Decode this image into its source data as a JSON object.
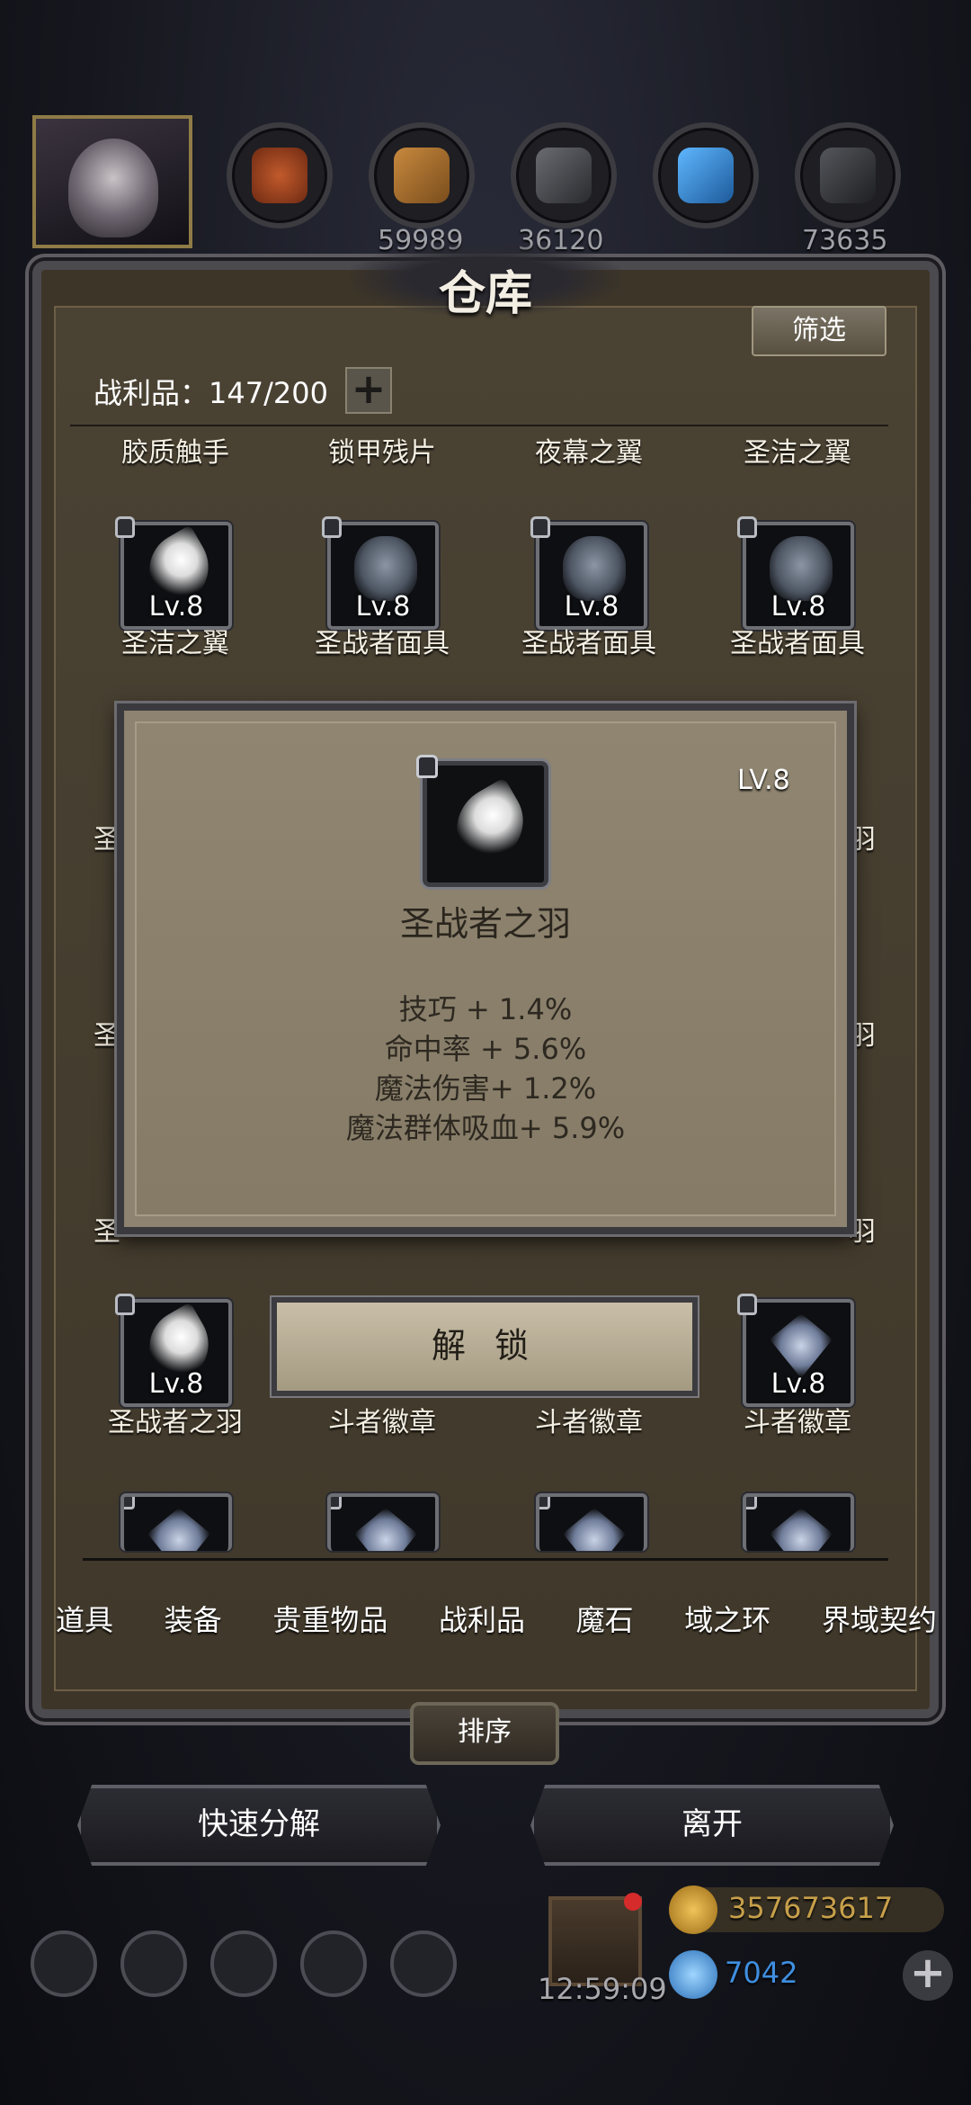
{
  "resources": {
    "values": [
      "59989",
      "36120",
      "",
      "73635"
    ]
  },
  "window": {
    "title": "仓库",
    "filter_label": "筛选",
    "count_label": "战利品：147/200",
    "add_label": "+"
  },
  "grid": {
    "header_labels": [
      "胶质触手",
      "锁甲残片",
      "夜幕之翼",
      "圣洁之翼"
    ],
    "row1": [
      {
        "lv": "Lv.8",
        "name": "圣洁之翼",
        "icon": "feather-icon"
      },
      {
        "lv": "Lv.8",
        "name": "圣战者面具",
        "icon": "mask-icon"
      },
      {
        "lv": "Lv.8",
        "name": "圣战者面具",
        "icon": "mask-icon"
      },
      {
        "lv": "Lv.8",
        "name": "圣战者面具",
        "icon": "mask-icon"
      }
    ],
    "row_bottom": [
      {
        "lv": "Lv.8",
        "name": "圣战者之羽",
        "icon": "feather-icon"
      },
      {
        "lv": "",
        "name": "斗者徽章",
        "icon": "badge-icon"
      },
      {
        "lv": "",
        "name": "斗者徽章",
        "icon": "badge-icon"
      },
      {
        "lv": "Lv.8",
        "name": "斗者徽章",
        "icon": "badge-icon"
      }
    ],
    "side_left": [
      "圣",
      "圣",
      "圣"
    ],
    "side_right": [
      "羽",
      "羽",
      "羽"
    ]
  },
  "popup": {
    "level": "LV.8",
    "name": "圣战者之羽",
    "stats": [
      "技巧 + 1.4%",
      "命中率 + 5.6%",
      "魔法伤害+ 1.2%",
      "魔法群体吸血+ 5.9%"
    ],
    "unlock_label": "解 锁"
  },
  "tabs": [
    "道具",
    "装备",
    "贵重物品",
    "战利品",
    "魔石",
    "域之环",
    "界域契约"
  ],
  "actions": {
    "sort_label": "排序",
    "quick_decompose_label": "快速分解",
    "leave_label": "离开"
  },
  "bottom": {
    "timer": "12:59:09",
    "gold": "357673617",
    "gems": "7042"
  },
  "colors": {
    "gold_text": "#c7a04a",
    "gem_text": "#3f8fe0"
  }
}
